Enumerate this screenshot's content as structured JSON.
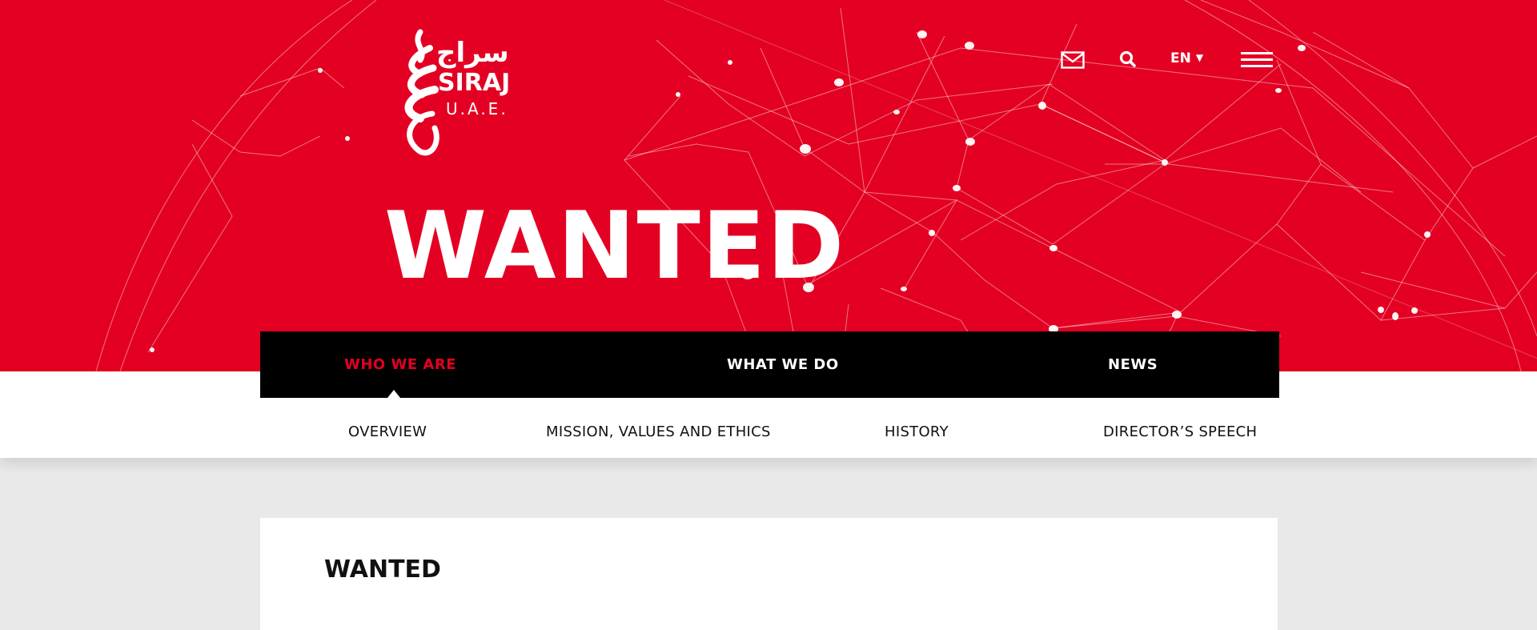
{
  "brand": {
    "arabic": "سراج",
    "name": "SIRAJ",
    "region": "U.A.E.",
    "colors": {
      "primary_red": "#e30022",
      "nav_black": "#000000",
      "page_gray": "#e9e9ea"
    }
  },
  "header": {
    "mail_icon": "envelope-icon",
    "search_icon": "magnifier-icon",
    "language": "EN",
    "menu_icon": "hamburger-icon"
  },
  "hero": {
    "title": "WANTED"
  },
  "main_nav": {
    "items": [
      {
        "label": "WHO WE ARE",
        "active": true
      },
      {
        "label": "WHAT WE DO",
        "active": false
      },
      {
        "label": "NEWS",
        "active": false
      }
    ]
  },
  "sub_nav": {
    "items": [
      {
        "label": "OVERVIEW"
      },
      {
        "label": "MISSION, VALUES AND ETHICS"
      },
      {
        "label": "HISTORY"
      },
      {
        "label": "DIRECTOR’S SPEECH"
      }
    ]
  },
  "content": {
    "title": "WANTED"
  }
}
